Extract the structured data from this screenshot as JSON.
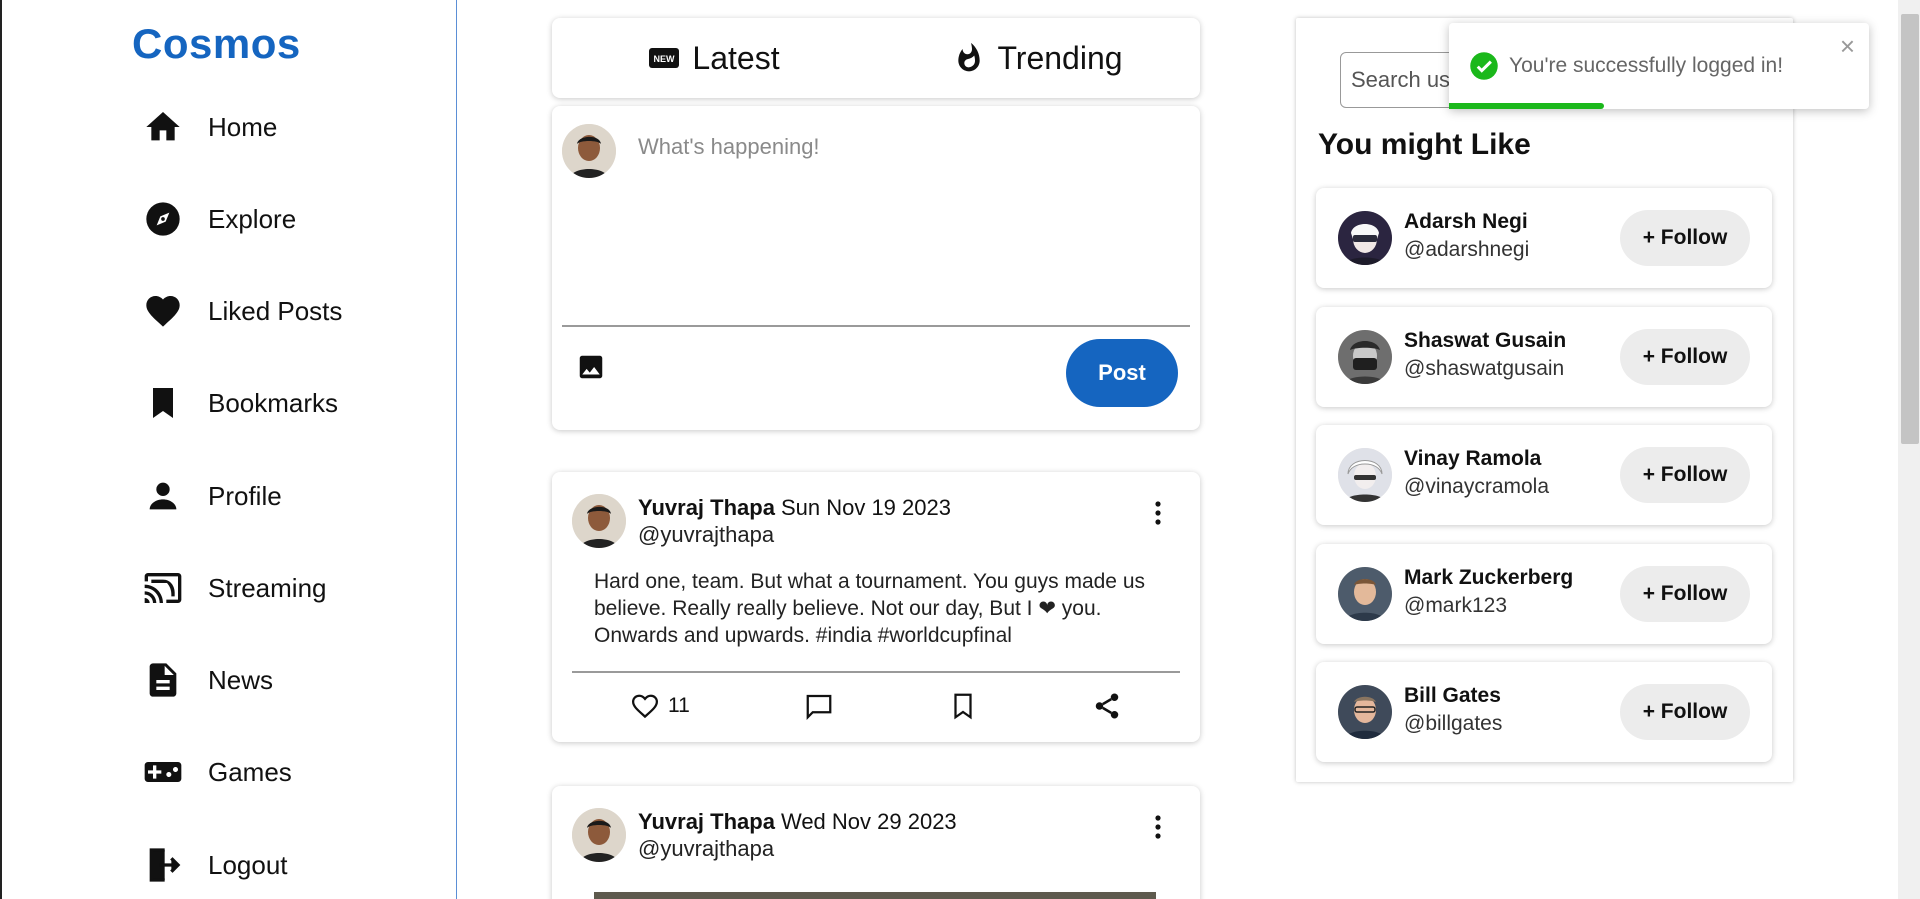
{
  "brand": "Cosmos",
  "nav": [
    {
      "label": "Home",
      "icon": "home-icon"
    },
    {
      "label": "Explore",
      "icon": "compass-icon"
    },
    {
      "label": "Liked Posts",
      "icon": "heart-icon"
    },
    {
      "label": "Bookmarks",
      "icon": "bookmark-icon"
    },
    {
      "label": "Profile",
      "icon": "person-icon"
    },
    {
      "label": "Streaming",
      "icon": "cast-icon"
    },
    {
      "label": "News",
      "icon": "article-icon"
    },
    {
      "label": "Games",
      "icon": "gamepad-icon"
    },
    {
      "label": "Logout",
      "icon": "logout-icon"
    }
  ],
  "tabs": [
    {
      "label": "Latest",
      "icon": "new-badge-icon"
    },
    {
      "label": "Trending",
      "icon": "flame-icon"
    }
  ],
  "composer": {
    "placeholder": "What's happening!",
    "post_label": "Post"
  },
  "posts": [
    {
      "name": "Yuvraj Thapa",
      "date": "Sun Nov 19 2023",
      "handle": "@yuvrajthapa",
      "body": "Hard one, team. But what a tournament. You guys made us believe. Really really believe. Not our day, But I ❤ you. Onwards and upwards. #india #worldcupfinal",
      "likes": "11"
    },
    {
      "name": "Yuvraj Thapa",
      "date": "Wed Nov 29 2023",
      "handle": "@yuvrajthapa"
    }
  ],
  "right": {
    "search_placeholder": "Search us",
    "title": "You might Like",
    "follow_label": "+ Follow",
    "suggestions": [
      {
        "name": "Adarsh Negi",
        "handle": "@adarshnegi"
      },
      {
        "name": "Shaswat Gusain",
        "handle": "@shaswatgusain"
      },
      {
        "name": "Vinay Ramola",
        "handle": "@vinaycramola"
      },
      {
        "name": "Mark Zuckerberg",
        "handle": "@mark123"
      },
      {
        "name": "Bill Gates",
        "handle": "@billgates"
      }
    ]
  },
  "toast": {
    "message": "You're successfully logged in!",
    "close": "×",
    "progress": 0.37
  },
  "colors": {
    "brand": "#1565c0",
    "success": "#1bb81b"
  }
}
